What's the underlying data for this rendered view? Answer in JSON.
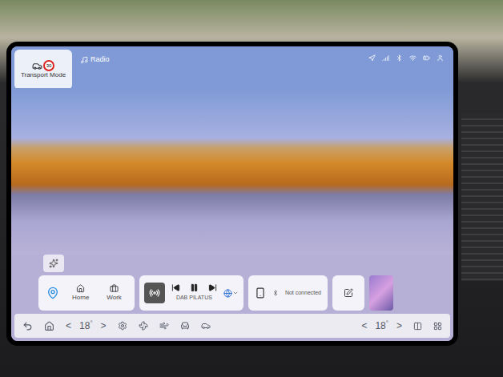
{
  "top_bar": {
    "transport_mode": {
      "label": "Transport Mode",
      "badge": "30"
    },
    "source": "Radio"
  },
  "navigation": {
    "items": [
      {
        "label": "Home"
      },
      {
        "label": "Work"
      }
    ]
  },
  "media": {
    "station": "DAB PILATUS",
    "playing": true
  },
  "phone": {
    "status": "Not connected"
  },
  "climate": {
    "driver": {
      "left": "<",
      "value": "18",
      "unit": "°",
      "right": ">"
    },
    "passenger": {
      "left": "<",
      "value": "18",
      "unit": "°",
      "right": ">"
    }
  }
}
